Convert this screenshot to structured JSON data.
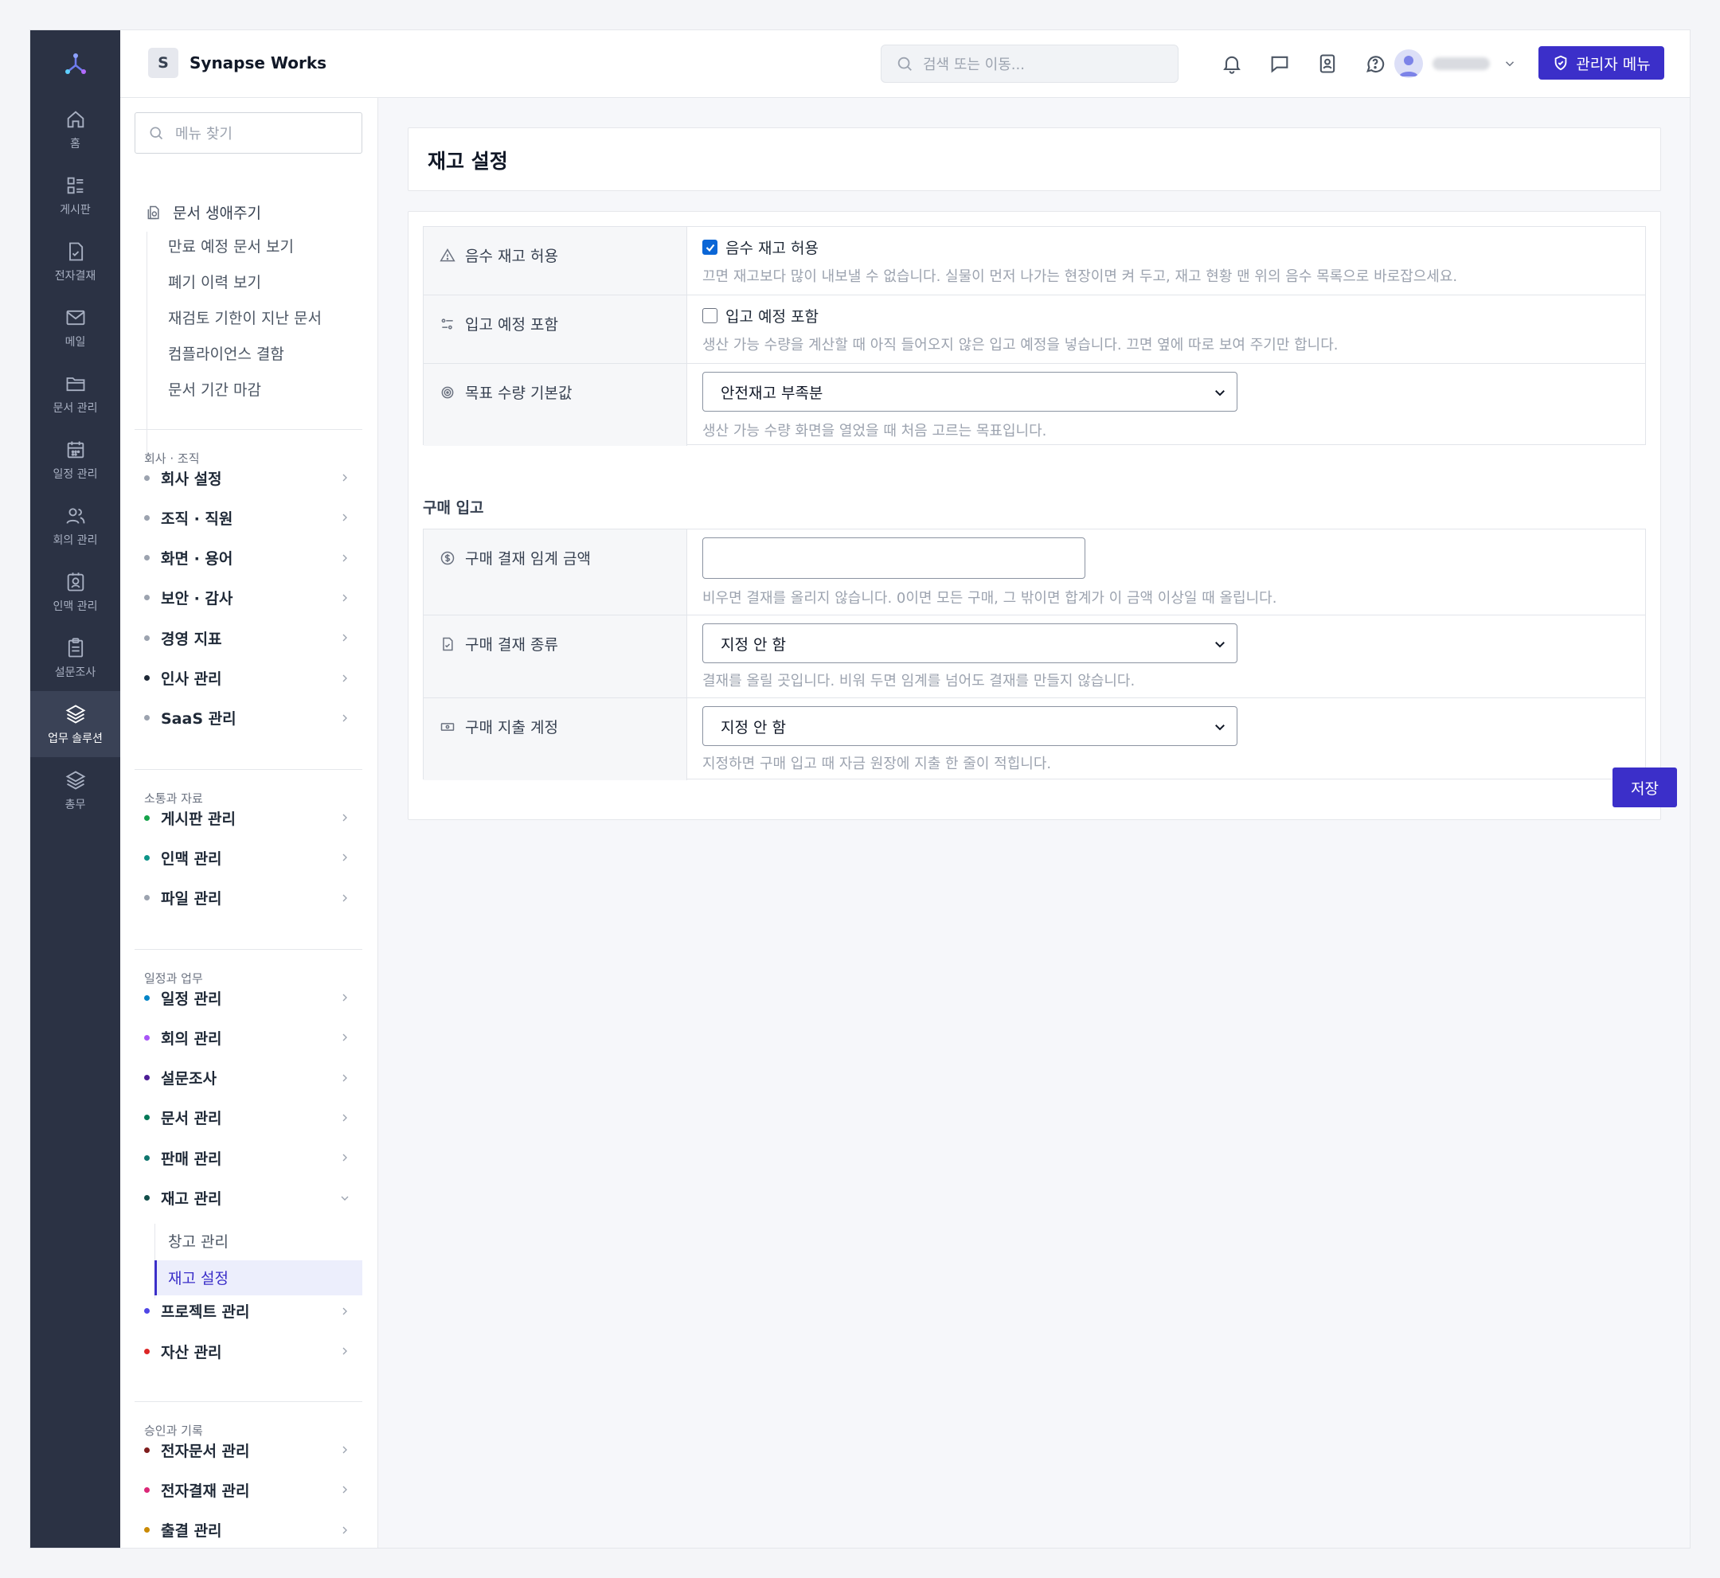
{
  "rail": {
    "items": [
      {
        "label": "홈",
        "icon": "home-icon"
      },
      {
        "label": "게시판",
        "icon": "board-icon"
      },
      {
        "label": "전자결재",
        "icon": "approval-icon"
      },
      {
        "label": "메일",
        "icon": "mail-icon"
      },
      {
        "label": "문서 관리",
        "icon": "folder-icon"
      },
      {
        "label": "일정 관리",
        "icon": "calendar-icon"
      },
      {
        "label": "회의 관리",
        "icon": "users-icon"
      },
      {
        "label": "인맥 관리",
        "icon": "contact-icon"
      },
      {
        "label": "설문조사",
        "icon": "clipboard-icon"
      },
      {
        "label": "업무 솔루션",
        "icon": "layers-icon"
      },
      {
        "label": "총무",
        "icon": "layers-icon"
      }
    ]
  },
  "header": {
    "company_initial": "S",
    "company_name": "Synapse Works",
    "search_placeholder": "검색 또는 이동...",
    "admin_label": "관리자 메뉴"
  },
  "menu": {
    "search_placeholder": "메뉴 찾기",
    "lifecycle": {
      "title": "문서 생애주기",
      "links": [
        "만료 예정 문서 보기",
        "폐기 이력 보기",
        "재검토 기한이 지난 문서",
        "컴플라이언스 결함",
        "문서 기간 마감"
      ]
    },
    "sections": [
      {
        "label": "회사 · 조직",
        "items": [
          "회사 설정",
          "조직 · 직원",
          "화면 · 용어",
          "보안 · 감사",
          "경영 지표",
          "인사 관리",
          "SaaS 관리"
        ]
      },
      {
        "label": "소통과 자료",
        "items": [
          "게시판 관리",
          "인맥 관리",
          "파일 관리"
        ]
      },
      {
        "label": "일정과 업무",
        "items": [
          "일정 관리",
          "회의 관리",
          "설문조사",
          "문서 관리",
          "판매 관리",
          "재고 관리",
          "프로젝트 관리",
          "자산 관리"
        ]
      },
      {
        "label": "승인과 기록",
        "items": [
          "전자문서 관리",
          "전자결재 관리",
          "출결 관리"
        ]
      }
    ],
    "inventory_children": [
      "창고 관리",
      "재고 설정"
    ]
  },
  "page": {
    "title": "재고 설정",
    "rows": [
      {
        "label": "음수 재고 허용",
        "check_label": "음수 재고 허용",
        "checked": true,
        "help": "끄면 재고보다 많이 내보낼 수 없습니다. 실물이 먼저 나가는 현장이면 켜 두고, 재고 현황 맨 위의 음수 목록으로 바로잡으세요."
      },
      {
        "label": "입고 예정 포함",
        "check_label": "입고 예정 포함",
        "checked": false,
        "help": "생산 가능 수량을 계산할 때 아직 들어오지 않은 입고 예정을 넣습니다. 끄면 옆에 따로 보여 주기만 합니다."
      },
      {
        "label": "목표 수량 기본값",
        "select_value": "안전재고 부족분",
        "help": "생산 가능 수량 화면을 열었을 때 처음 고르는 목표입니다."
      }
    ],
    "purchase_group": "구매 입고",
    "purchase_rows": [
      {
        "label": "구매 결재 임계 금액",
        "input_value": "",
        "help": "비우면 결재를 올리지 않습니다. 0이면 모든 구매, 그 밖이면 합계가 이 금액 이상일 때 올립니다."
      },
      {
        "label": "구매 결재 종류",
        "select_value": "지정 안 함",
        "help": "결재를 올릴 곳입니다. 비워 두면 임계를 넘어도 결재를 만들지 않습니다."
      },
      {
        "label": "구매 지출 계정",
        "select_value": "지정 안 함",
        "help": "지정하면 구매 입고 때 자금 원장에 지출 한 줄이 적힙니다."
      }
    ],
    "save_label": "저장"
  },
  "colors": {
    "accent": "#3b2fc9",
    "rail": "#2b3244",
    "dots": [
      "#9ca3af",
      "#9ca3af",
      "#9ca3af",
      "#9ca3af",
      "#9ca3af",
      "#1f2937",
      "#9ca3af",
      "#16a34a",
      "#0d9488",
      "#9ca3af",
      "#0284c7",
      "#a855f7",
      "#4c1d95",
      "#047857",
      "#0f766e",
      "#134e4a",
      "#4f46e5",
      "#dc2626",
      "#7f1d1d",
      "#db2777",
      "#ca8a04"
    ]
  }
}
